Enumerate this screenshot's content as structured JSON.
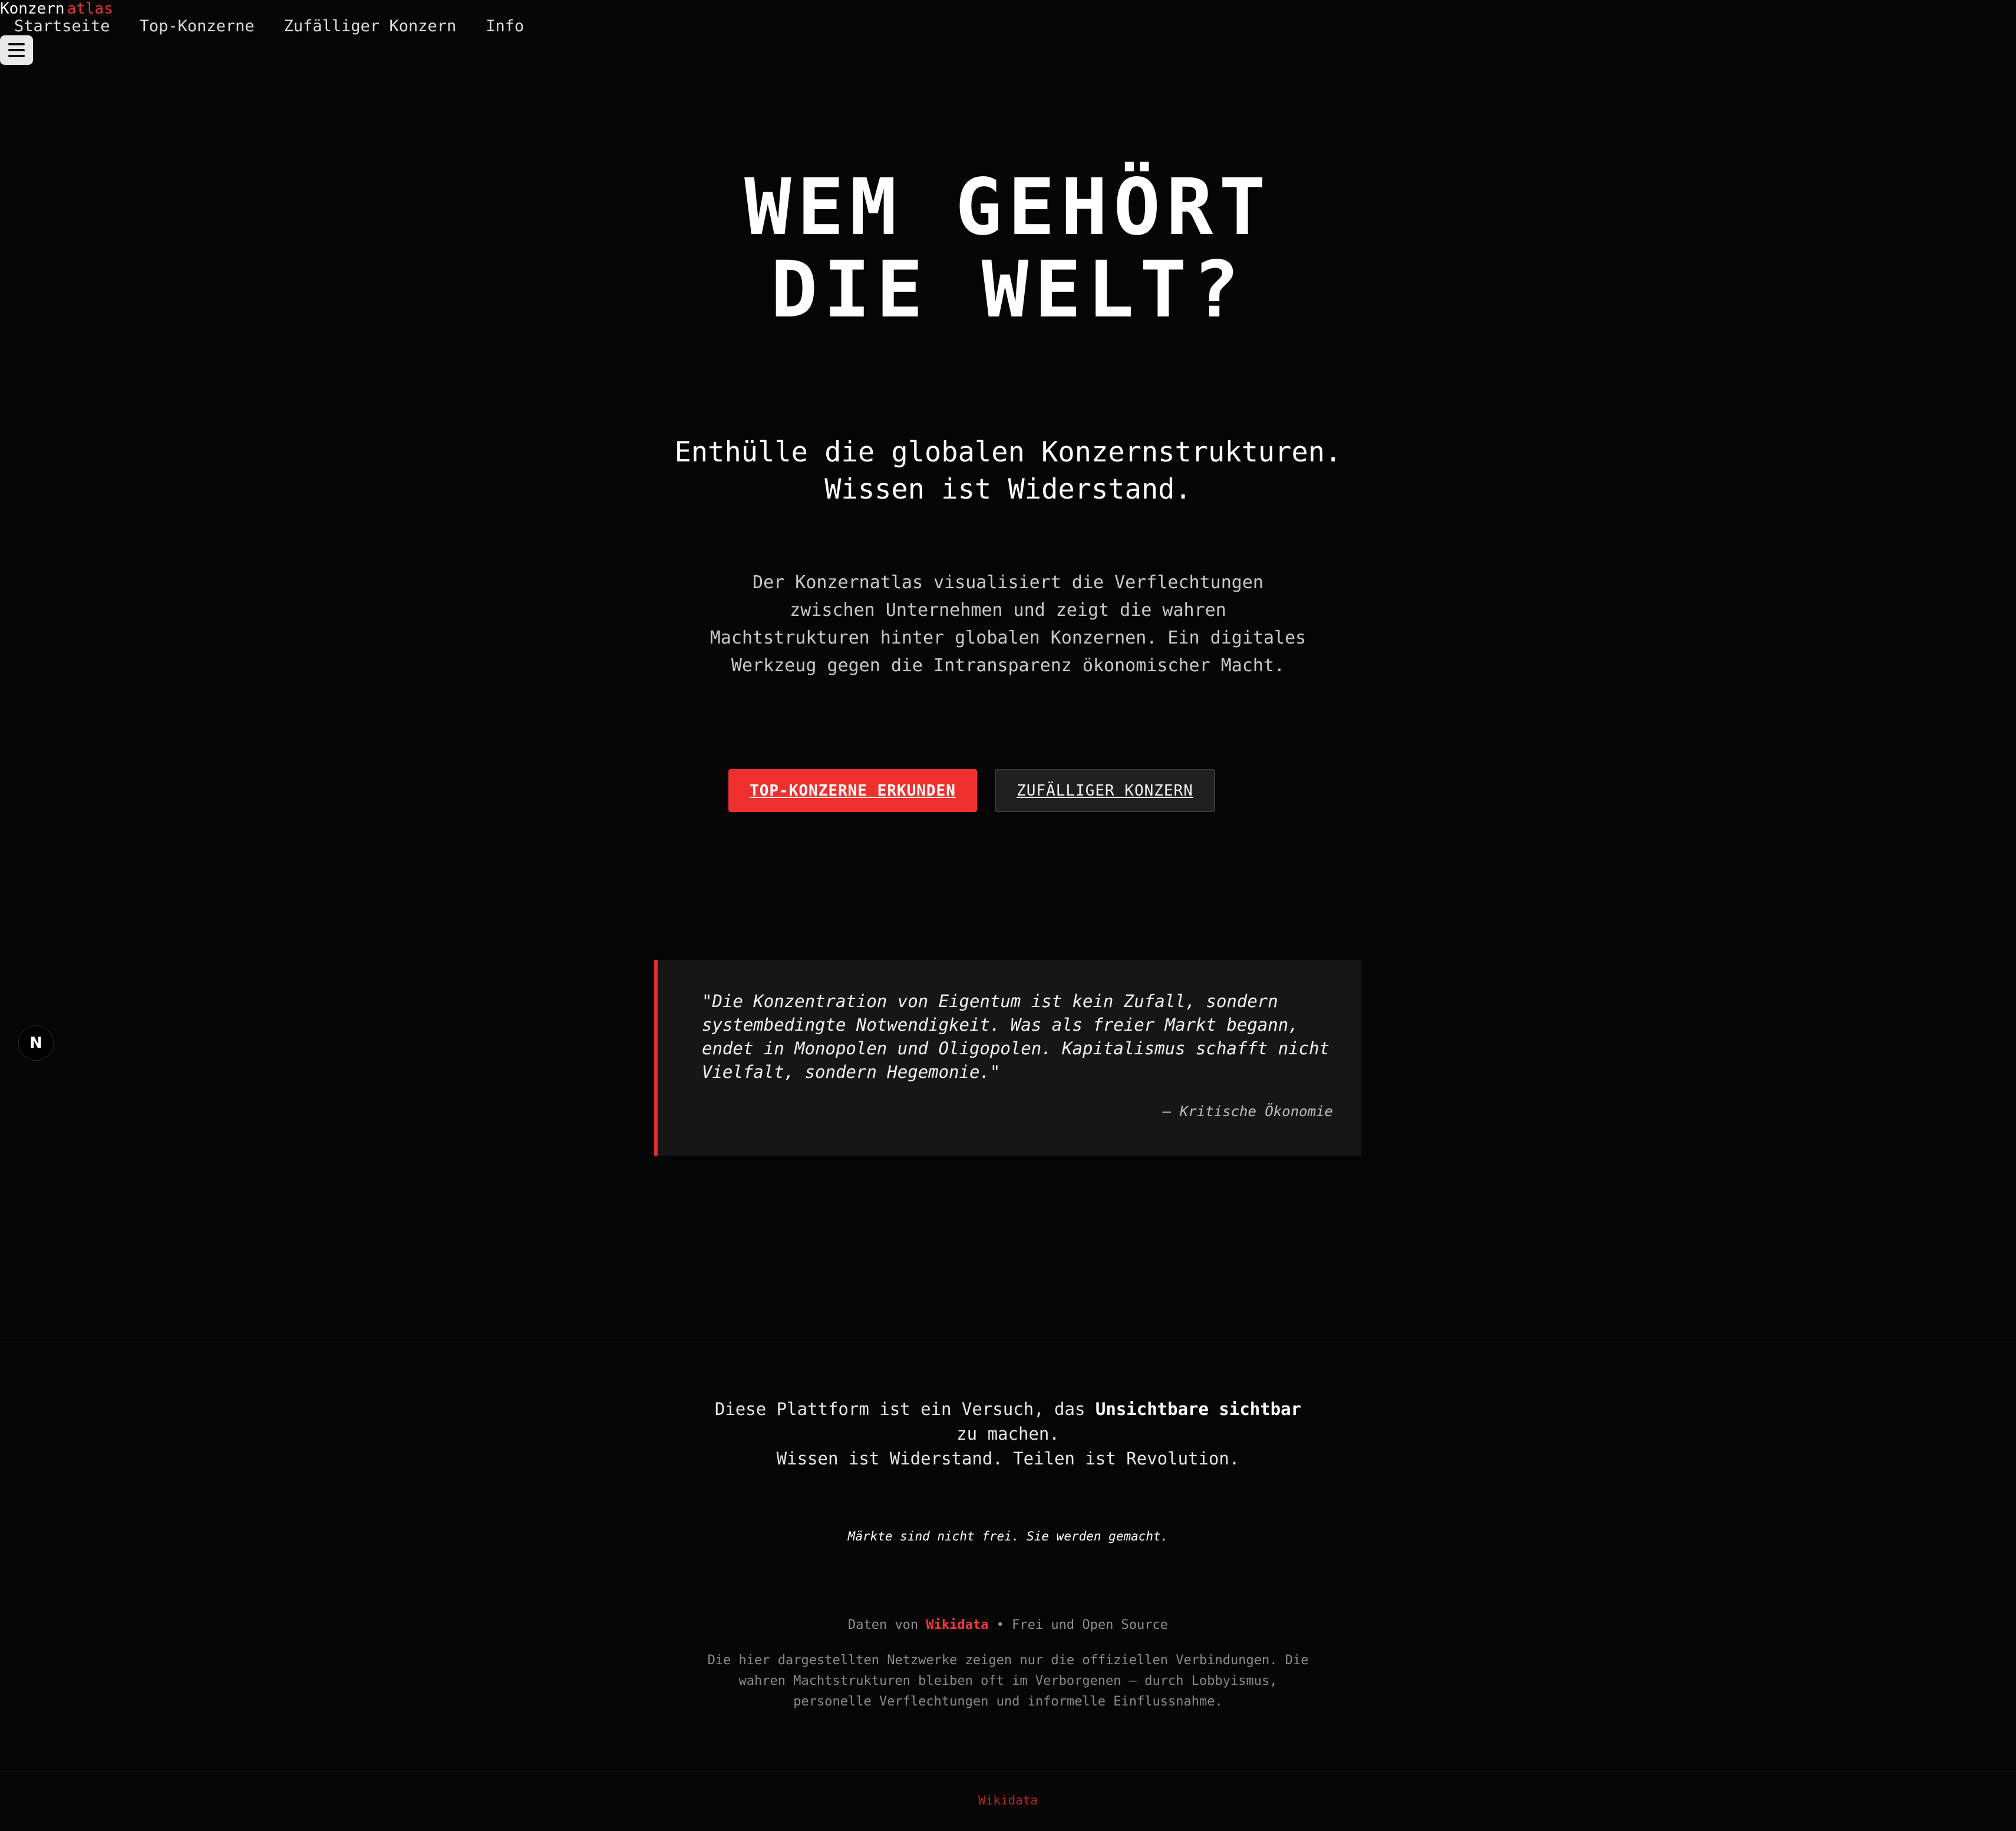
{
  "brand": {
    "part1": "Konzern",
    "part2": "atlas"
  },
  "nav": {
    "items": [
      {
        "label": "Startseite"
      },
      {
        "label": "Top-Konzerne"
      },
      {
        "label": "Zufälliger Konzern"
      },
      {
        "label": "Info"
      }
    ],
    "menu_icon": "hamburger-menu-icon"
  },
  "hero": {
    "title_line1": "WEM GEHÖRT",
    "title_line2": "DIE WELT?",
    "subtitle_line1": "Enthülle die globalen Konzernstrukturen.",
    "subtitle_line2": "Wissen ist Widerstand.",
    "intro": "Der Konzernatlas visualisiert die Verflechtungen zwischen Unternehmen und zeigt die wahren Machtstrukturen hinter globalen Konzernen. Ein digitales Werkzeug gegen die Intransparenz ökonomischer Macht.",
    "primary_button": "TOP-KONZERNE ERKUNDEN",
    "secondary_button": "ZUFÄLLIGER KONZERN"
  },
  "quote": {
    "text": "\"Die Konzentration von Eigentum ist kein Zufall, sondern systembedingte Notwendigkeit. Was als freier Markt begann, endet in Monopolen und Oligopolen. Kapitalismus schafft nicht Vielfalt, sondern Hegemonie.\"",
    "attribution": "— Kritische Ökonomie"
  },
  "badge": {
    "label": "N",
    "icon": "nextjs-logo-icon"
  },
  "footer": {
    "mission_before": "Diese Plattform ist ein Versuch, das ",
    "mission_bold": "Unsichtbare sichtbar",
    "mission_after": " zu machen.",
    "mission_line2": "Wissen ist Widerstand. Teilen ist Revolution.",
    "tagline": "Märkte sind nicht frei. Sie werden gemacht.",
    "credit_prefix": "Daten von ",
    "credit_link": "Wikidata",
    "credit_suffix": " • Frei und Open Source",
    "disclaimer": "Die hier dargestellten Netzwerke zeigen nur die offiziellen Verbindungen. Die wahren Machtstrukturen bleiben oft im Verborgenen – durch Lobbyismus, personelle Verflechtungen und informelle Einflussnahme.",
    "bottom_link": "Wikidata"
  },
  "colors": {
    "accent": "#f0302f",
    "background": "#050505"
  }
}
